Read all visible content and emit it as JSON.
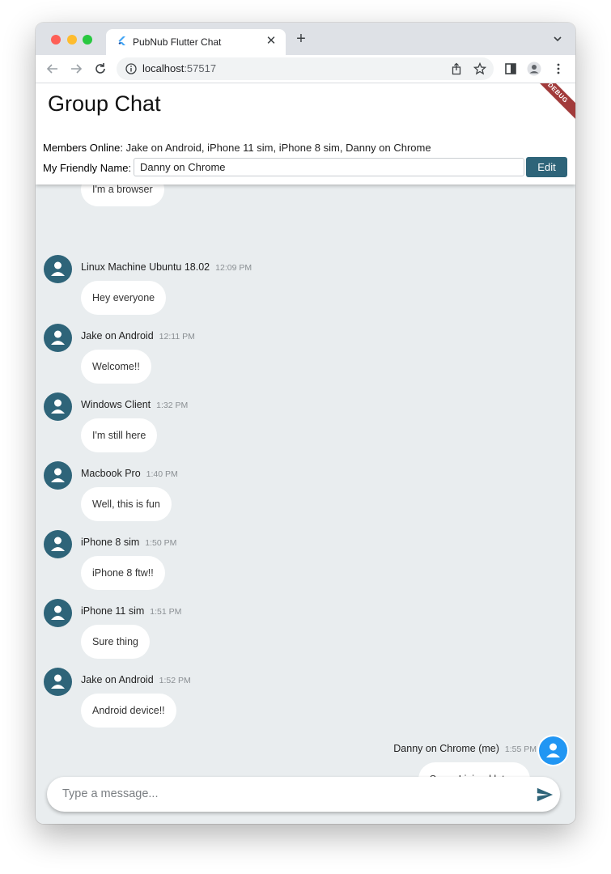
{
  "browser": {
    "tab_title": "PubNub Flutter Chat",
    "url_host": "localhost",
    "url_port": ":57517"
  },
  "app": {
    "title": "Group Chat",
    "debug_banner": "DEBUG",
    "members_label": "Members Online:",
    "members_value": "Jake on Android, iPhone 11 sim, iPhone 8 sim, Danny on Chrome",
    "friendly_label": "My Friendly Name:",
    "friendly_value": "Danny on Chrome",
    "edit_label": "Edit"
  },
  "messages": [
    {
      "sender": "",
      "time": "",
      "text": "I'm a browser",
      "me": false
    },
    {
      "sender": "Linux Machine Ubuntu 18.02",
      "time": "12:09 PM",
      "text": "Hey everyone",
      "me": false
    },
    {
      "sender": "Jake on Android",
      "time": "12:11 PM",
      "text": "Welcome!!",
      "me": false
    },
    {
      "sender": "Windows Client",
      "time": "1:32 PM",
      "text": "I'm still here",
      "me": false
    },
    {
      "sender": "Macbook Pro",
      "time": "1:40 PM",
      "text": "Well, this is fun",
      "me": false
    },
    {
      "sender": "iPhone 8 sim",
      "time": "1:50 PM",
      "text": "iPhone 8 ftw!!",
      "me": false
    },
    {
      "sender": "iPhone 11 sim",
      "time": "1:51 PM",
      "text": "Sure thing",
      "me": false
    },
    {
      "sender": "Jake on Android",
      "time": "1:52 PM",
      "text": "Android device!!",
      "me": false
    },
    {
      "sender": "Danny on Chrome (me)",
      "time": "1:55 PM",
      "text": "Sorry, I joined late...",
      "me": true
    }
  ],
  "composer": {
    "placeholder": "Type a message..."
  },
  "colors": {
    "accent": "#2e6479",
    "me_avatar": "#2196f3",
    "background": "#e9edef"
  },
  "icons": {
    "tab_favicon": "flutter-icon",
    "send": "send-icon",
    "avatar": "person-icon"
  }
}
